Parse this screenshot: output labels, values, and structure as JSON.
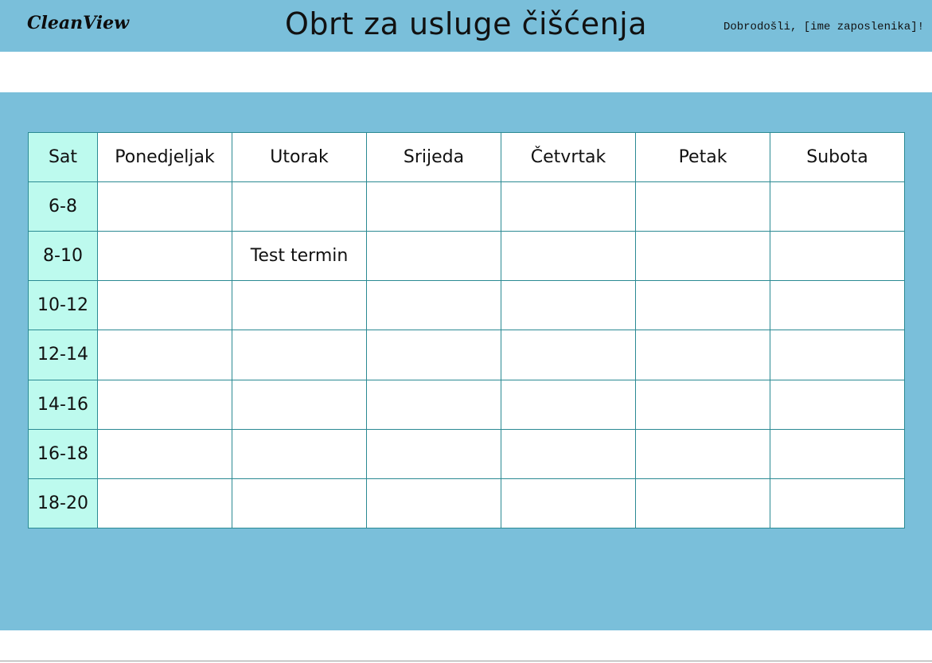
{
  "header": {
    "logo": "CleanView",
    "title": "Obrt za usluge čišćenja",
    "welcome": "Dobrodošli, [ime zaposlenika]!"
  },
  "schedule": {
    "time_header": "Sat",
    "days": [
      "Ponedjeljak",
      "Utorak",
      "Srijeda",
      "Četvrtak",
      "Petak",
      "Subota"
    ],
    "rows": [
      {
        "time": "6-8",
        "cells": [
          "",
          "",
          "",
          "",
          "",
          ""
        ]
      },
      {
        "time": "8-10",
        "cells": [
          "",
          "Test termin",
          "",
          "",
          "",
          ""
        ]
      },
      {
        "time": "10-12",
        "cells": [
          "",
          "",
          "",
          "",
          "",
          ""
        ]
      },
      {
        "time": "12-14",
        "cells": [
          "",
          "",
          "",
          "",
          "",
          ""
        ]
      },
      {
        "time": "14-16",
        "cells": [
          "",
          "",
          "",
          "",
          "",
          ""
        ]
      },
      {
        "time": "16-18",
        "cells": [
          "",
          "",
          "",
          "",
          "",
          ""
        ]
      },
      {
        "time": "18-20",
        "cells": [
          "",
          "",
          "",
          "",
          "",
          ""
        ]
      }
    ]
  },
  "colors": {
    "header_bg": "#7abfda",
    "time_column_bg": "#bdfaee",
    "grid_border": "#2b8a93"
  }
}
